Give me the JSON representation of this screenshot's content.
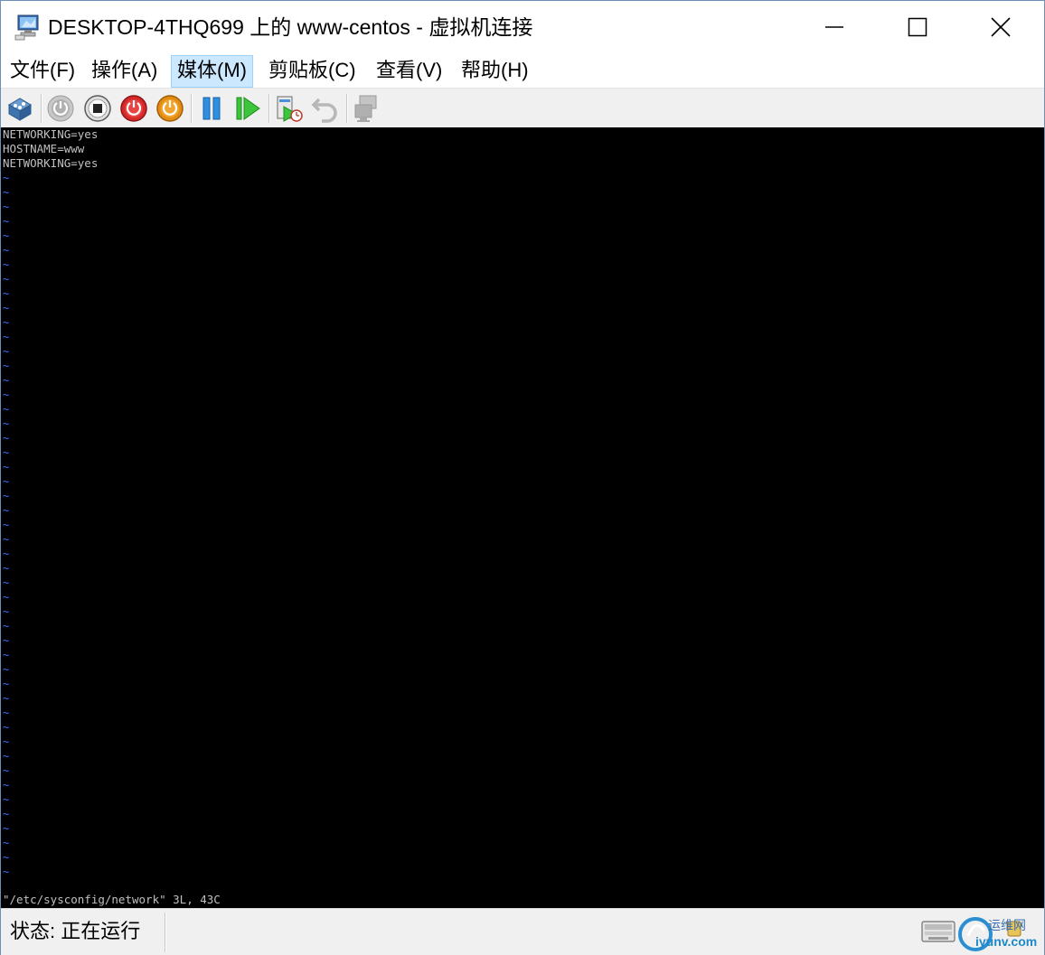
{
  "window": {
    "title": "DESKTOP-4THQ699 上的 www-centos - 虚拟机连接"
  },
  "menu": [
    {
      "label": "文件(F)"
    },
    {
      "label": "操作(A)"
    },
    {
      "label": "媒体(M)"
    },
    {
      "label": "剪贴板(C)"
    },
    {
      "label": "查看(V)"
    },
    {
      "label": "帮助(H)"
    }
  ],
  "toolbar": {
    "icons": [
      "ctrl-alt-del-icon",
      "start-icon",
      "turn-off-icon",
      "shutdown-icon",
      "save-icon",
      "pause-icon",
      "resume-icon",
      "checkpoint-icon",
      "revert-icon",
      "enhanced-session-icon"
    ]
  },
  "console": {
    "lines": [
      "NETWORKING=yes",
      "HOSTNAME=www",
      "NETWORKING=yes"
    ],
    "tilde": "~",
    "status_line": "\"/etc/sysconfig/network\" 3L, 43C"
  },
  "statusbar": {
    "state": "状态: 正在运行",
    "watermark_top": "运维网",
    "watermark_bottom": "iyunv.com"
  },
  "colors": {
    "console_bg": "#000000",
    "console_text": "#c0c0c0",
    "tilde": "#4a6cff",
    "menu_hover": "#cce8ff"
  }
}
